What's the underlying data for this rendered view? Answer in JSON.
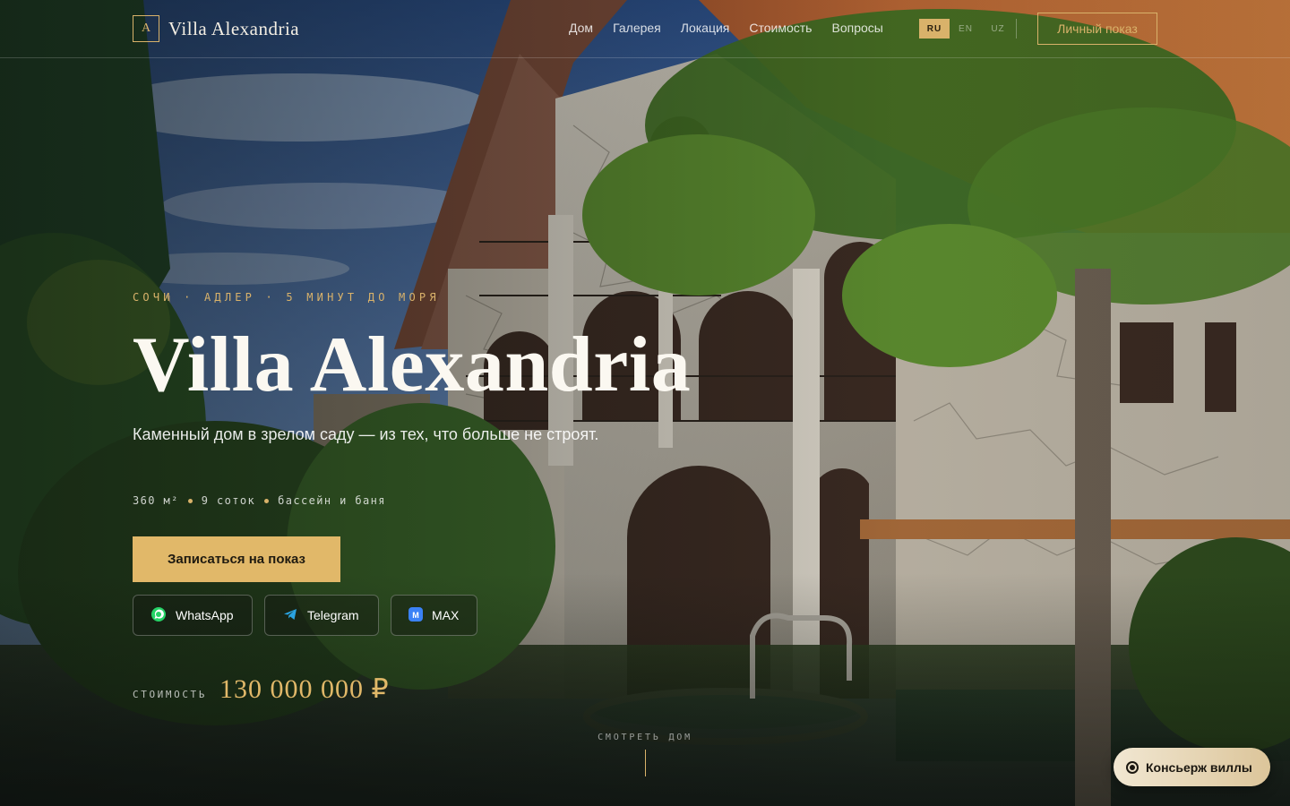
{
  "header": {
    "logo_mark": "A",
    "logo_text": "Villa Alexandria",
    "nav": [
      "Дом",
      "Галерея",
      "Локация",
      "Стоимость",
      "Вопросы"
    ],
    "languages": [
      "RU",
      "EN",
      "UZ"
    ],
    "active_language": "RU",
    "cta_label": "Личный показ"
  },
  "hero": {
    "eyebrow": "СОЧИ · АДЛЕР · 5 МИНУТ ДО МОРЯ",
    "title": "Villa Alexandria",
    "subtitle": "Каменный дом в зрелом саду — из тех, что больше не строят.",
    "specs": [
      "360 м²",
      "9 соток",
      "бассейн и баня"
    ],
    "primary_button": "Записаться на показ",
    "messengers": [
      {
        "label": "WhatsApp",
        "icon": "whatsapp-icon",
        "color": "#25d366"
      },
      {
        "label": "Telegram",
        "icon": "telegram-icon",
        "color": "#2aa3e0"
      },
      {
        "label": "MAX",
        "icon": "max-icon",
        "color": "#3b82f6"
      }
    ],
    "price_label": "СТОИМОСТЬ",
    "price_value": "130 000 000 ₽",
    "scroll_label": "СМОТРЕТЬ ДОМ"
  },
  "concierge_label": "Консьерж виллы",
  "colors": {
    "accent_gold": "#e1b869",
    "text_light": "#fbf8f1"
  }
}
